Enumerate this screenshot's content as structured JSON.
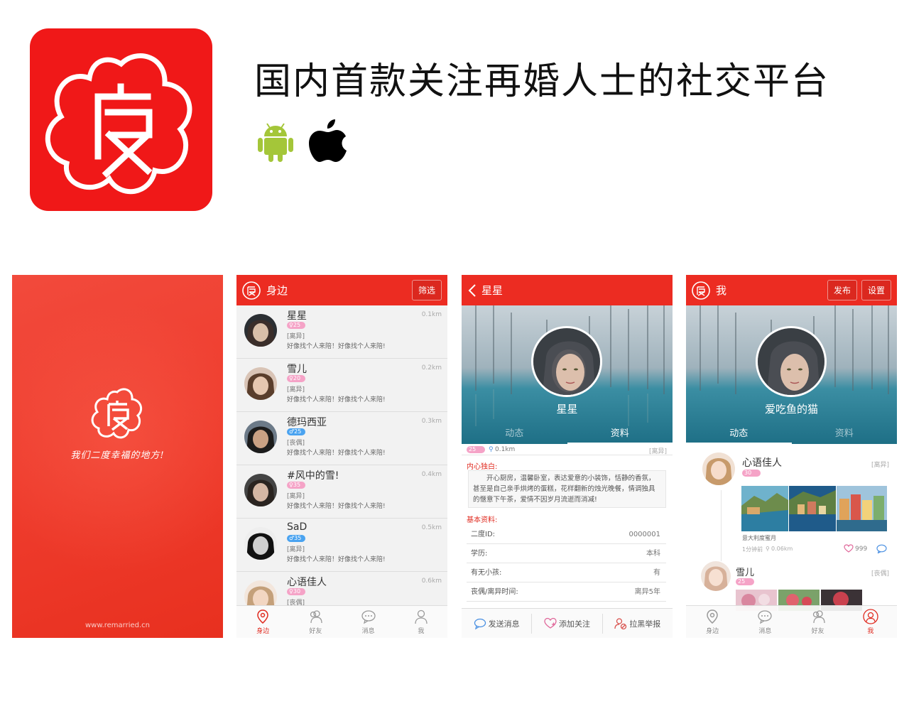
{
  "header": {
    "headline": "国内首款关注再婚人士的社交平台",
    "platform_icons": [
      "android-icon",
      "apple-icon"
    ],
    "brand_color": "#f01818"
  },
  "splash": {
    "slogan": "我们二度幸福的地方!",
    "footer_url": "www.remarried.cn"
  },
  "nearby_screen": {
    "title": "身边",
    "filter_label": "筛选",
    "people": [
      {
        "name": "星星",
        "badge": "25",
        "gender": "female",
        "status": "[离异]",
        "signature": "好像找个人来陪！好像找个人来陪!",
        "distance": "0.1km"
      },
      {
        "name": "雪儿",
        "badge": "20",
        "gender": "female",
        "status": "[离异]",
        "signature": "好像找个人来陪！好像找个人来陪!",
        "distance": "0.2km"
      },
      {
        "name": "德玛西亚",
        "badge": "25",
        "gender": "male",
        "status": "[丧偶]",
        "signature": "好像找个人来陪！好像找个人来陪!",
        "distance": "0.3km"
      },
      {
        "name": "#风中的雪!",
        "badge": "35",
        "gender": "female",
        "status": "[离异]",
        "signature": "好像找个人来陪！好像找个人来陪!",
        "distance": "0.4km"
      },
      {
        "name": "SaD",
        "badge": "35",
        "gender": "male",
        "status": "[离异]",
        "signature": "好像找个人来陪！好像找个人来陪!",
        "distance": "0.5km"
      },
      {
        "name": "心语佳人",
        "badge": "30",
        "gender": "female",
        "status": "[丧偶]",
        "signature": "",
        "distance": "0.6km"
      }
    ],
    "nav": [
      "身边",
      "好友",
      "消息",
      "我"
    ]
  },
  "profile_screen": {
    "title": "星星",
    "name": "星星",
    "tabs": [
      "动态",
      "资料"
    ],
    "badge": "25",
    "distance": "0.1km",
    "status": "[离异]",
    "monologue_label": "内心独白:",
    "monologue": "开心厨房，温馨卧室，表达爱意的小装饰，恬静的香氛，甚至是自己亲手烘烤的蛋糕，花样翻新的烛光晚餐，情调独具的惬意下午茶，爱情不因岁月流逝而消减!",
    "basic_label": "基本资料:",
    "fields": [
      {
        "label": "二度ID:",
        "value": "0000001"
      },
      {
        "label": "学历:",
        "value": "本科"
      },
      {
        "label": "有无小孩:",
        "value": "有"
      },
      {
        "label": "丧偶/离异时间:",
        "value": "离异5年"
      }
    ],
    "actions": [
      "发送消息",
      "添加关注",
      "拉黑举报"
    ]
  },
  "me_screen": {
    "title": "我",
    "publish_label": "发布",
    "settings_label": "设置",
    "name": "爱吃鱼的猫",
    "tabs": [
      "动态",
      "资料"
    ],
    "posts": [
      {
        "name": "心语佳人",
        "badge": "30",
        "status": "[离异]",
        "caption": "意大利度蜜月",
        "time": "1分钟前",
        "distance": "0.06km",
        "likes": "999"
      },
      {
        "name": "雪儿",
        "badge": "25",
        "status": "[丧偶]"
      }
    ],
    "nav": [
      "身边",
      "消息",
      "好友",
      "我"
    ]
  }
}
